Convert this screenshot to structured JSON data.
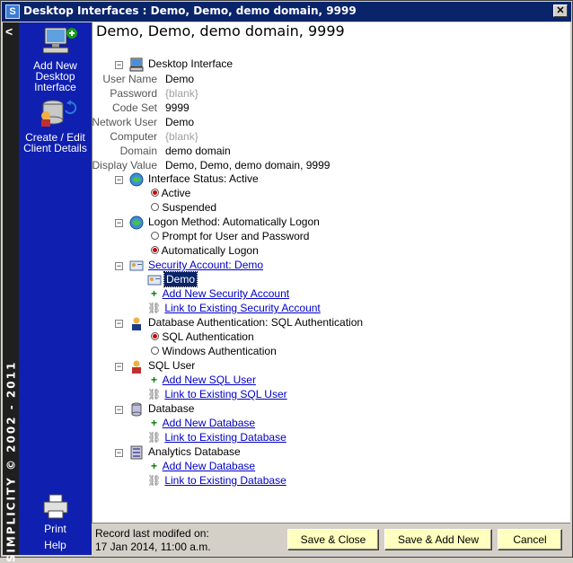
{
  "window": {
    "title": "Desktop Interfaces : Demo, Demo, demo domain, 9999",
    "close": "✕"
  },
  "strip": {
    "collapse": "<",
    "vertical_text": "SIMPLICITY © 2002 - 2011"
  },
  "sidebar": {
    "add": "Add New Desktop Interface",
    "edit": "Create / Edit Client Details",
    "print": "Print",
    "help": "Help"
  },
  "header": {
    "title": "Demo, Demo, demo domain, 9999"
  },
  "tree": {
    "root": "Desktop Interface",
    "fields": [
      {
        "label": "User Name",
        "value": "Demo",
        "placeholder": false
      },
      {
        "label": "Password",
        "value": "{blank}",
        "placeholder": true
      },
      {
        "label": "Code Set",
        "value": "9999",
        "placeholder": false
      },
      {
        "label": "Network User",
        "value": "Demo",
        "placeholder": false
      },
      {
        "label": "Computer",
        "value": "{blank}",
        "placeholder": true
      },
      {
        "label": "Domain",
        "value": "demo domain",
        "placeholder": false
      },
      {
        "label": "Display Value",
        "value": "Demo, Demo, demo domain, 9999",
        "placeholder": false
      }
    ],
    "interface_status": {
      "label": "Interface Status:  Active",
      "opt1": "Active",
      "opt2": "Suspended"
    },
    "logon_method": {
      "label": "Logon Method:  Automatically Logon",
      "opt1": "Prompt for User and Password",
      "opt2": "Automatically Logon"
    },
    "security_account": {
      "label": "Security Account:  Demo",
      "selected": "Demo",
      "add": "Add New Security Account",
      "link": "Link to Existing Security Account"
    },
    "db_auth": {
      "label": "Database Authentication:  SQL Authentication",
      "opt1": "SQL Authentication",
      "opt2": "Windows Authentication"
    },
    "sql_user": {
      "label": "SQL User",
      "add": "Add New SQL User",
      "link": "Link to Existing SQL User"
    },
    "database": {
      "label": "Database",
      "add": "Add New Database",
      "link": "Link to Existing Database"
    },
    "analytics_db": {
      "label": "Analytics Database",
      "add": "Add New Database",
      "link": "Link to Existing Database"
    }
  },
  "footer": {
    "record_line1": "Record last modifed on:",
    "record_line2": "17 Jan 2014, 11:00 a.m.",
    "save_close": "Save & Close",
    "save_add": "Save & Add New",
    "cancel": "Cancel"
  },
  "colors": {
    "sidebar": "#0f1fb0",
    "strip": "#1f1f1f",
    "titlebar": "#0a246a",
    "button": "#ffffc0",
    "link": "#0000c8",
    "radio_on": "#d40000"
  }
}
